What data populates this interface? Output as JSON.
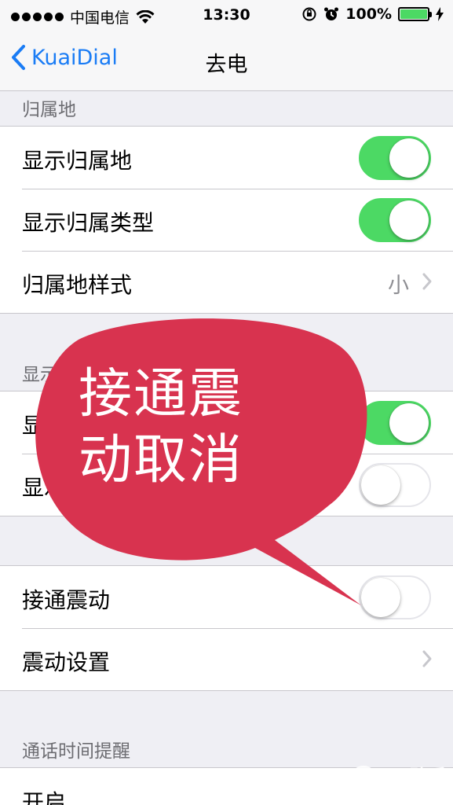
{
  "status_bar": {
    "carrier": "中国电信",
    "time": "13:30",
    "battery": "100%",
    "battery_color": "#4cd964"
  },
  "nav": {
    "back_label": "KuaiDial",
    "title": "去电",
    "accent_color": "#1a7cf5"
  },
  "sections": {
    "attribution": {
      "header": "归属地",
      "rows": [
        {
          "label": "显示归属地",
          "toggle": "on"
        },
        {
          "label": "显示归属类型",
          "toggle": "on"
        },
        {
          "label": "归属地样式",
          "detail": "小"
        }
      ]
    },
    "display": {
      "header": "显示",
      "rows": [
        {
          "label": "显示",
          "toggle": "on"
        },
        {
          "label": "显示",
          "toggle": "off"
        }
      ]
    },
    "vibration": {
      "rows": [
        {
          "label": "接通震动",
          "toggle": "off"
        },
        {
          "label": "震动设置"
        }
      ]
    },
    "call_timer": {
      "header": "通话时间提醒",
      "rows": [
        {
          "label": "开启"
        }
      ]
    }
  },
  "overlay": {
    "line1": "接通震",
    "line2": "动取消",
    "bubble_color": "#d8334f"
  },
  "watermark": {
    "brand": "PP助手",
    "site": "25PP.COM"
  }
}
